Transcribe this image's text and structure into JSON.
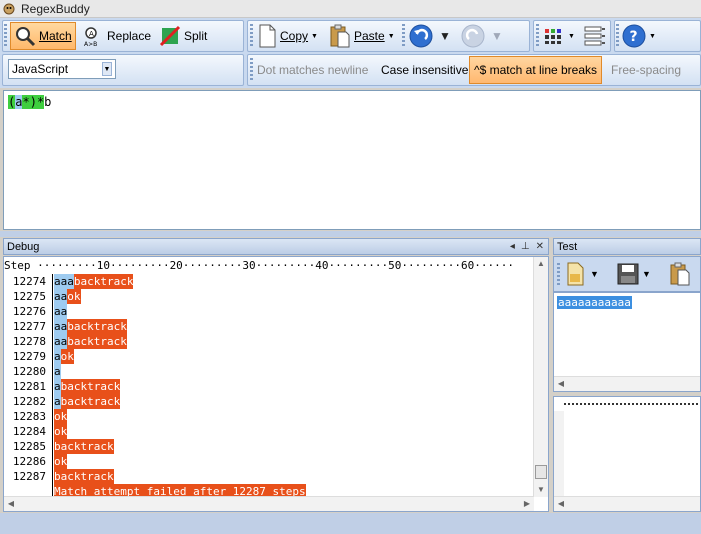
{
  "window": {
    "title": "RegexBuddy"
  },
  "toolbar": {
    "match_label": "Match",
    "replace_label": "Replace",
    "split_label": "Split",
    "copy_label": "Copy",
    "paste_label": "Paste"
  },
  "flavor": {
    "selected": "JavaScript"
  },
  "options": {
    "dot_newline": "Dot matches newline",
    "case_insensitive": "Case insensitive",
    "line_breaks": "^$ match at line breaks",
    "free_spacing": "Free-spacing"
  },
  "regex": {
    "parts": [
      {
        "text": "(",
        "style": "green"
      },
      {
        "text": "a",
        "style": "blue"
      },
      {
        "text": "*",
        "style": "green"
      },
      {
        "text": ")",
        "style": "green"
      },
      {
        "text": "*",
        "style": "green"
      },
      {
        "text": "b",
        "style": "plain"
      }
    ]
  },
  "debug": {
    "panel_title": "Debug",
    "ruler": "Step ·········10·········20·········30·········40·········50·········60······",
    "lines": [
      {
        "step": "12274",
        "matched": "aaa",
        "result": "backtrack"
      },
      {
        "step": "12275",
        "matched": "aa",
        "result": "ok"
      },
      {
        "step": "12276",
        "matched": "aa",
        "result": ""
      },
      {
        "step": "12277",
        "matched": "aa",
        "result": "backtrack"
      },
      {
        "step": "12278",
        "matched": "aa",
        "result": "backtrack"
      },
      {
        "step": "12279",
        "matched": "a",
        "result": "ok"
      },
      {
        "step": "12280",
        "matched": "a",
        "result": ""
      },
      {
        "step": "12281",
        "matched": "a",
        "result": "backtrack"
      },
      {
        "step": "12282",
        "matched": "a",
        "result": "backtrack"
      },
      {
        "step": "12283",
        "matched": "",
        "result": "ok"
      },
      {
        "step": "12284",
        "matched": "",
        "result": "ok"
      },
      {
        "step": "12285",
        "matched": "",
        "result": "backtrack"
      },
      {
        "step": "12286",
        "matched": "",
        "result": "ok"
      },
      {
        "step": "12287",
        "matched": "",
        "result": "backtrack"
      },
      {
        "step": "",
        "matched": "",
        "result": "Match attempt failed after 12287 steps"
      }
    ]
  },
  "test": {
    "panel_title": "Test",
    "subject": "aaaaaaaaaaa"
  },
  "colors": {
    "highlight_blue": "#9ecbf0",
    "highlight_red": "#e8501a",
    "active_orange": "#ffb86b",
    "regex_green": "#3fce3f"
  }
}
